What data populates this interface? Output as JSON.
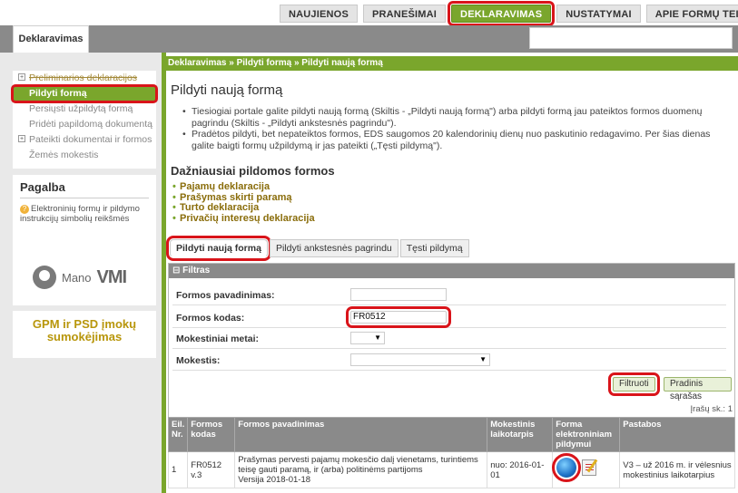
{
  "topnav": {
    "tabs": [
      {
        "label": "NAUJIENOS"
      },
      {
        "label": "PRANEŠIMAI"
      },
      {
        "label": "DEKLARAVIMAS"
      },
      {
        "label": "NUSTATYMAI"
      },
      {
        "label": "APIE FORMŲ TEIKIMĄ"
      }
    ]
  },
  "header": {
    "main_tab": "Deklaravimas"
  },
  "sidebar": {
    "items": [
      {
        "label": "Preliminarios deklaracijos"
      },
      {
        "label": "Pildyti formą"
      },
      {
        "label": "Persiųsti užpildytą formą"
      },
      {
        "label": "Pridėti papildomą dokumentą"
      },
      {
        "label": "Pateikti dokumentai ir formos"
      },
      {
        "label": "Žemės mokestis"
      }
    ],
    "help": {
      "title": "Pagalba",
      "text": "Elektroninių formų ir pildymo instrukcijų simbolių reikšmės"
    },
    "vmi_logo": {
      "mano": "Mano",
      "vmi": "VMI"
    },
    "gpm_banner": "GPM ir PSD įmokų sumokėjimas"
  },
  "main": {
    "breadcrumb": "Deklaravimas » Pildyti formą » Pildyti naują formą",
    "title": "Pildyti naują formą",
    "intro": [
      "Tiesiogiai portale galite pildyti naują formą (Skiltis - „Pildyti naują formą\") arba pildyti formą jau pateiktos formos duomenų pagrindu (Skiltis - „Pildyti ankstesnės pagrindu\").",
      "Pradėtos pildyti, bet nepateiktos formos, EDS saugomos 20 kalendorinių dienų nuo paskutinio redagavimo. Per šias dienas galite baigti formų užpildymą ir jas pateikti („Tęsti pildymą\")."
    ],
    "frequent": {
      "title": "Dažniausiai pildomos formos",
      "items": [
        {
          "label": "Pajamų deklaracija"
        },
        {
          "label": "Prašymas skirti paramą"
        },
        {
          "label": "Turto deklaracija"
        },
        {
          "label": "Privačių interesų deklaracija"
        }
      ]
    },
    "form_tabs": [
      {
        "label": "Pildyti naują formą"
      },
      {
        "label": "Pildyti ankstesnės pagrindu"
      },
      {
        "label": "Tęsti pildymą"
      }
    ],
    "filter": {
      "header": "Filtras",
      "form_name_label": "Formos pavadinimas:",
      "form_name_value": "",
      "form_code_label": "Formos kodas:",
      "form_code_value": "FR0512",
      "tax_year_label": "Mokestiniai metai:",
      "tax_label": "Mokestis:",
      "filter_button": "Filtruoti",
      "reset_button": "Pradinis sąrašas"
    },
    "record_count": "Įrašų sk.: 1",
    "table": {
      "headers": [
        "Eil. Nr.",
        "Formos kodas",
        "Formos pavadinimas",
        "Mokestinis laikotarpis",
        "Forma elektroniniam pildymui",
        "Pastabos"
      ],
      "rows": [
        {
          "nr": "1",
          "code": "FR0512 v.3",
          "name": "Prašymas pervesti pajamų mokesčio dalį vienetams, turintiems teisę gauti paramą, ir (arba) politinėms partijoms",
          "version": "Versija 2018-01-18",
          "period": "nuo: 2016-01-01",
          "note": "V3 – už 2016 m. ir vėlesnius mokestinius laikotarpius"
        }
      ]
    }
  }
}
